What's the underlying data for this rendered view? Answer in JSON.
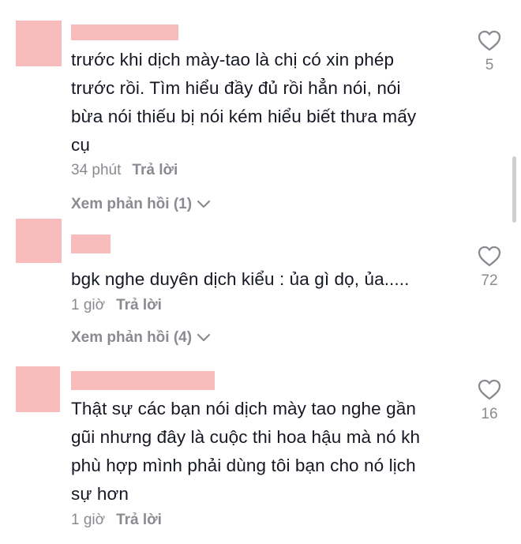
{
  "comments": [
    {
      "text": "trước khi dịch mày-tao là chị có xin phép\ntrước rồi. Tìm hiểu đầy đủ rồi hẳn nói, nói\nbừa nói thiếu bị nói kém hiểu biết thưa mấy\ncụ",
      "time": "34 phút",
      "reply_label": "Trả lời",
      "view_replies": "Xem phản hồi (1)",
      "likes": "5"
    },
    {
      "text": "bgk nghe duyên dịch kiểu : ủa gì dọ, ủa.....",
      "time": "1 giờ",
      "reply_label": "Trả lời",
      "view_replies": "Xem phản hồi (4)",
      "likes": "72"
    },
    {
      "text": "Thật sự các bạn nói dịch mày tao nghe gần\ngũi nhưng đây là cuộc thi hoa hậu mà nó kh\nphù hợp mình phải dùng tôi bạn cho nó lịch\nsự hơn",
      "time": "1 giờ",
      "reply_label": "Trả lời",
      "likes": "16"
    }
  ],
  "icons": {
    "like": "heart-outline-icon",
    "expand": "chevron-down-icon"
  },
  "colors": {
    "redaction": "#f8bcbc",
    "text": "#161823",
    "muted": "#8a8b91"
  }
}
